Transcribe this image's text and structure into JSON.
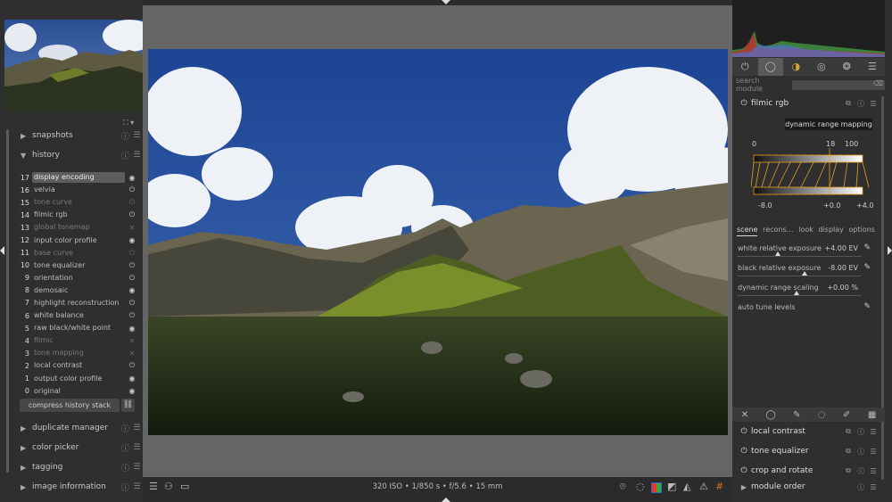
{
  "left_panel": {
    "sections": {
      "snapshots": "snapshots",
      "history": "history",
      "duplicate_manager": "duplicate manager",
      "color_picker": "color picker",
      "tagging": "tagging",
      "image_information": "image information"
    },
    "history_items": [
      {
        "num": "17",
        "label": "display encoding",
        "status": "on",
        "selected": true,
        "dim": false
      },
      {
        "num": "16",
        "label": "velvia",
        "status": "power",
        "selected": false,
        "dim": false
      },
      {
        "num": "15",
        "label": "tone curve",
        "status": "power",
        "selected": false,
        "dim": true
      },
      {
        "num": "14",
        "label": "filmic rgb",
        "status": "power",
        "selected": false,
        "dim": false
      },
      {
        "num": "13",
        "label": "global tonemap",
        "status": "off",
        "selected": false,
        "dim": true
      },
      {
        "num": "12",
        "label": "input color profile",
        "status": "on",
        "selected": false,
        "dim": false
      },
      {
        "num": "11",
        "label": "base curve",
        "status": "power",
        "selected": false,
        "dim": true
      },
      {
        "num": "10",
        "label": "tone equalizer",
        "status": "power",
        "selected": false,
        "dim": false
      },
      {
        "num": "9",
        "label": "orientation",
        "status": "power",
        "selected": false,
        "dim": false
      },
      {
        "num": "8",
        "label": "demosaic",
        "status": "on",
        "selected": false,
        "dim": false
      },
      {
        "num": "7",
        "label": "highlight reconstruction",
        "status": "power",
        "selected": false,
        "dim": false
      },
      {
        "num": "6",
        "label": "white balance",
        "status": "power",
        "selected": false,
        "dim": false
      },
      {
        "num": "5",
        "label": "raw black/white point",
        "status": "on",
        "selected": false,
        "dim": false
      },
      {
        "num": "4",
        "label": "filmic",
        "status": "off",
        "selected": false,
        "dim": true
      },
      {
        "num": "3",
        "label": "tone mapping",
        "status": "off",
        "selected": false,
        "dim": true
      },
      {
        "num": "2",
        "label": "local contrast",
        "status": "power",
        "selected": false,
        "dim": false
      },
      {
        "num": "1",
        "label": "output color profile",
        "status": "on",
        "selected": false,
        "dim": false
      },
      {
        "num": "0",
        "label": "original",
        "status": "on",
        "selected": false,
        "dim": false
      }
    ],
    "compress_button": "compress history stack"
  },
  "status_bar": {
    "exif": "320 ISO • 1/850 s • f/5.6 • 15 mm"
  },
  "right_panel": {
    "search_label": "search module",
    "active_module": {
      "name": "filmic rgb",
      "drm_button": "dynamic range mapping",
      "graph_top_labels": [
        "0",
        "18",
        "100"
      ],
      "graph_bottom_labels": [
        "-8.0",
        "+0.0",
        "+4.0"
      ],
      "subtabs": [
        "scene",
        "recons…",
        "look",
        "display",
        "options"
      ],
      "sliders": [
        {
          "label": "white relative exposure",
          "value": "+4.00 EV",
          "picker": true,
          "fraction": 0.33
        },
        {
          "label": "black relative exposure",
          "value": "-8.00 EV",
          "picker": true,
          "fraction": 0.54
        },
        {
          "label": "dynamic range scaling",
          "value": "+0.00 %",
          "picker": false,
          "fraction": 0.48
        },
        {
          "label": "auto tune levels",
          "value": "",
          "picker": true,
          "fraction": null
        }
      ]
    },
    "modules": [
      {
        "name": "local contrast"
      },
      {
        "name": "tone equalizer"
      },
      {
        "name": "crop and rotate"
      }
    ],
    "module_order": "module order"
  },
  "colors": {
    "panel_bg": "#2f2f2f",
    "center_bg": "#656565",
    "selected_row": "#5d5d5d",
    "graph_accent": "#e8a020"
  }
}
